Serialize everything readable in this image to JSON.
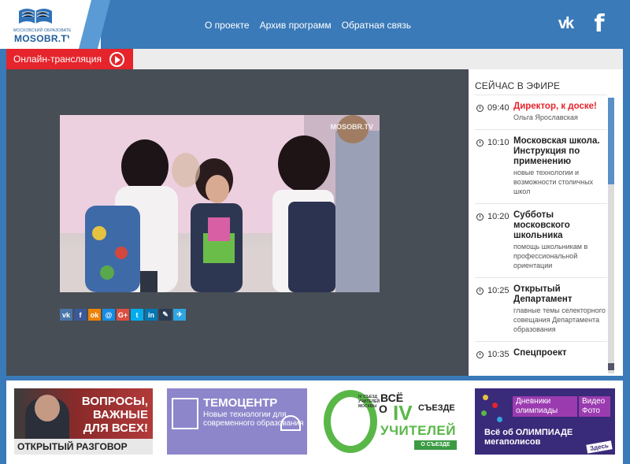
{
  "header": {
    "logo_small": "МОСКОВСКИЙ ОБРАЗОВАТЕЛЬНЫЙ",
    "logo_main": "MOSOBR.TV",
    "nav": [
      "О проекте",
      "Архив программ",
      "Обратная связь"
    ],
    "social": {
      "vk": "vk",
      "facebook": "f"
    }
  },
  "online": {
    "label": "Онлайн-трансляция"
  },
  "video": {
    "watermark": "MOSOBR.TV"
  },
  "share": [
    {
      "icon": "vk-icon",
      "glyph": "vk",
      "color": "#4a76a8"
    },
    {
      "icon": "facebook-icon",
      "glyph": "f",
      "color": "#3b5998"
    },
    {
      "icon": "odnoklassniki-icon",
      "glyph": "ok",
      "color": "#ee8208"
    },
    {
      "icon": "moimir-icon",
      "glyph": "@",
      "color": "#168de2"
    },
    {
      "icon": "googleplus-icon",
      "glyph": "G+",
      "color": "#dc4e41"
    },
    {
      "icon": "twitter-icon",
      "glyph": "t",
      "color": "#00aced"
    },
    {
      "icon": "linkedin-icon",
      "glyph": "in",
      "color": "#0077b5"
    },
    {
      "icon": "livejournal-icon",
      "glyph": "✎",
      "color": "#2a3b52"
    },
    {
      "icon": "yandex-icon",
      "glyph": "✈",
      "color": "#2ea5e0"
    }
  ],
  "schedule": {
    "title": "СЕЙЧАС В ЭФИРЕ",
    "items": [
      {
        "time": "09:40",
        "name": "Директор, к доске!",
        "desc": "Ольга Ярославская",
        "live": true
      },
      {
        "time": "10:10",
        "name": "Московская школа. Инструкция по применению",
        "desc": "новые технологии и возможности столичных школ",
        "live": false
      },
      {
        "time": "10:20",
        "name": "Субботы московского школьника",
        "desc": "помощь школьникам в профессиональной ориентации",
        "live": false
      },
      {
        "time": "10:25",
        "name": "Открытый Департамент",
        "desc": "главные темы селекторного совещания Департамента образования",
        "live": false
      },
      {
        "time": "10:35",
        "name": "Спецпроект",
        "desc": "",
        "live": false
      }
    ]
  },
  "banners": {
    "b1": {
      "head": "ВОПРОСЫ, ВАЖНЫЕ ДЛЯ ВСЕХ!",
      "foot": "ОТКРЫТЫЙ РАЗГОВОР"
    },
    "b2": {
      "title": "ТЕМОЦЕНТР",
      "sub": "Новые технологии для современного образования"
    },
    "b3": {
      "small": "IV СЪЕЗД УЧИТЕЛЕЙ МОСКВЫ",
      "w1": "ВСЁ",
      "w2": "О",
      "w3": "IV",
      "w4": "СЪЕЗДЕ",
      "w5": "УЧИТЕЛЕЙ",
      "btn": "О СЪЕЗДЕ"
    },
    "b4": {
      "p1": "Дневники олимпиады",
      "p2": "Видео Фото",
      "big": "Всё об ОЛИМПИАДЕ мегаполисов",
      "here": "Здесь"
    }
  }
}
